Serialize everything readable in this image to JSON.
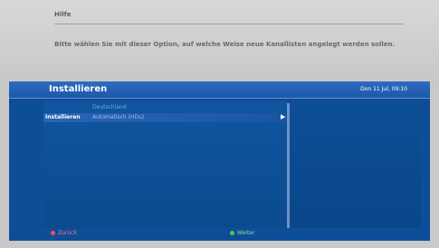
{
  "help": {
    "title": "Hilfe",
    "text": "Bitte wählen Sie mit dieser Option, auf welche Weise neue Kanallisten angelegt werden sollen."
  },
  "header": {
    "title": "Installieren",
    "clock": "Don 11 Jul, 09:10"
  },
  "option": {
    "above_value": "Deutschland",
    "label": "Installieren",
    "value": "Automatisch (HDu)",
    "arrow_icon": "chevron-right-icon"
  },
  "footer": {
    "back_label": "Zurück",
    "next_label": "Weiter"
  },
  "colors": {
    "screen_bg": "#0e4d98",
    "header_bg": "#1d58aa",
    "back": "#ff4a4a",
    "next": "#45d045"
  }
}
